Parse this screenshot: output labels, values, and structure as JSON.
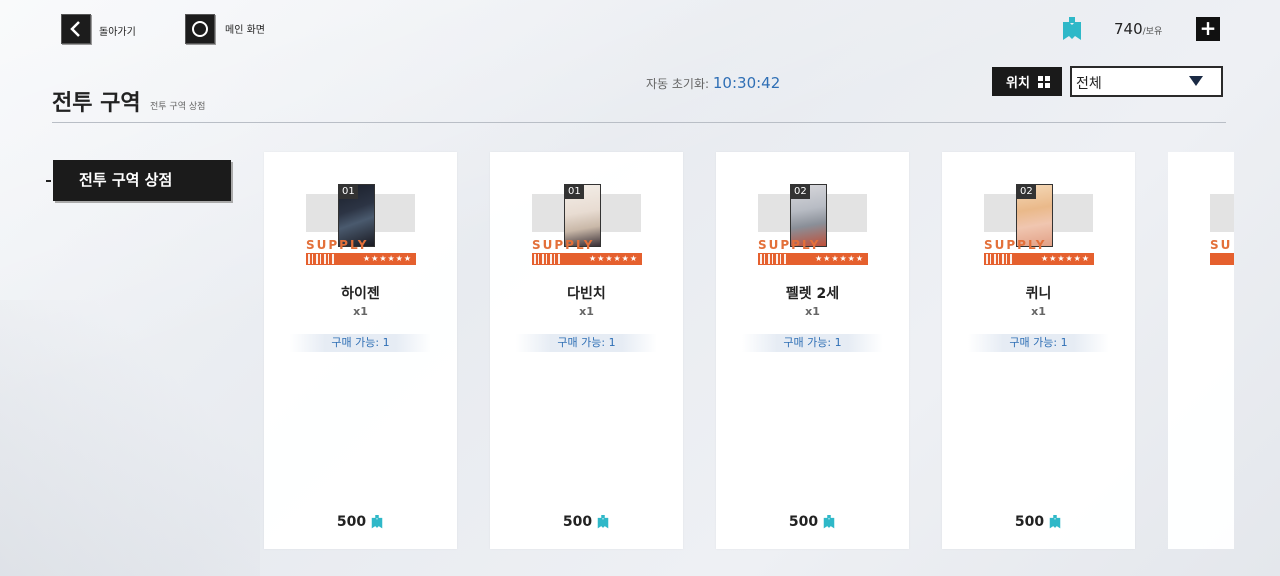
{
  "header": {
    "back_label": "돌아가기",
    "home_label": "메인 화면",
    "currency_amount": "740",
    "currency_suffix": "/보유",
    "add_label": "+"
  },
  "title": {
    "main": "전투 구역",
    "sub": "전투 구역 상점"
  },
  "reset": {
    "label": "자동 초기화:",
    "time": "10:30:42"
  },
  "filter": {
    "position_label": "위치",
    "selected": "전체"
  },
  "sidebar": {
    "tab_label": "전투 구역 상점"
  },
  "items": [
    {
      "slot": "01",
      "name": "하이젠",
      "qty": "x1",
      "limit": "구매 가능: 1",
      "price": "500",
      "supply": "SUPPLY",
      "stars": "★★★★★★"
    },
    {
      "slot": "01",
      "name": "다빈치",
      "qty": "x1",
      "limit": "구매 가능: 1",
      "price": "500",
      "supply": "SUPPLY",
      "stars": "★★★★★★"
    },
    {
      "slot": "02",
      "name": "펠렛 2세",
      "qty": "x1",
      "limit": "구매 가능: 1",
      "price": "500",
      "supply": "SUPPLY",
      "stars": "★★★★★★"
    },
    {
      "slot": "02",
      "name": "퀴니",
      "qty": "x1",
      "limit": "구매 가능: 1",
      "price": "500",
      "supply": "SUPPLY",
      "stars": "★★★★★★"
    }
  ],
  "colors": {
    "accent_orange": "#e5602e",
    "accent_blue": "#2f6fb5",
    "ticket_cyan": "#2fb8c8"
  }
}
